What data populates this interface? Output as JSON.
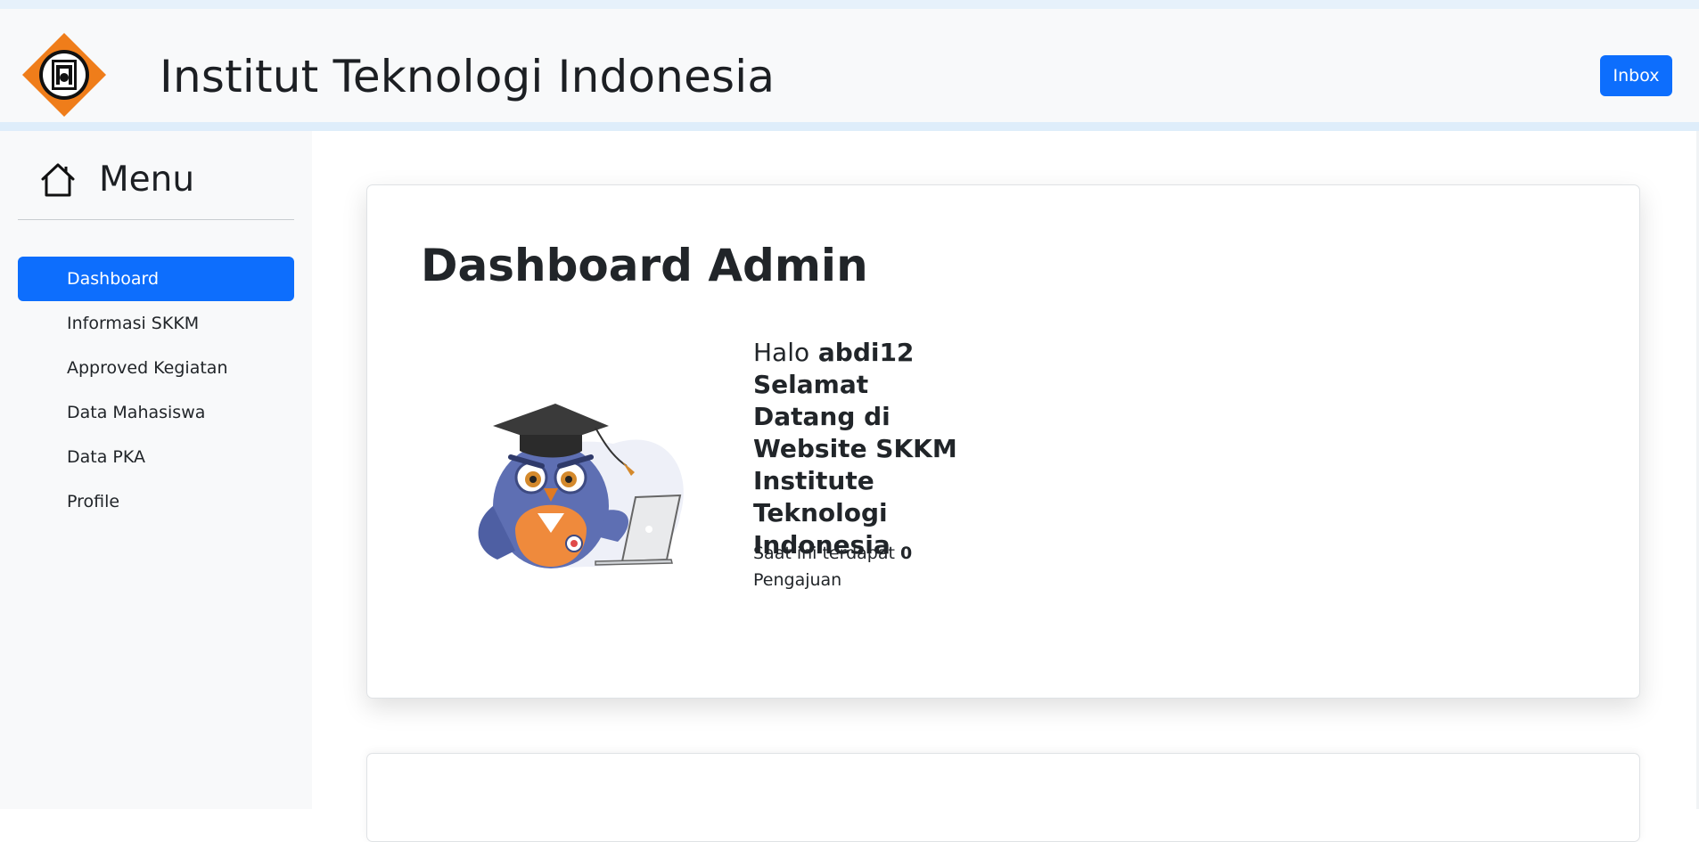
{
  "header": {
    "title": "Institut Teknologi Indonesia",
    "logo": "ITI emblem (orange diamond with black shield)",
    "inbox_label": "Inbox",
    "colors": {
      "background": "#f8f9fa",
      "primary": "#0d6efd",
      "logo_orange": "#ef7d1a"
    }
  },
  "sidebar": {
    "heading_icon": "home-icon",
    "heading": "Menu",
    "items": [
      {
        "label": "Dashboard",
        "active": true
      },
      {
        "label": "Informasi SKKM",
        "active": false
      },
      {
        "label": "Approved Kegiatan",
        "active": false
      },
      {
        "label": "Data Mahasiswa",
        "active": false
      },
      {
        "label": "Data PKA",
        "active": false
      },
      {
        "label": "Profile",
        "active": false
      }
    ]
  },
  "main": {
    "title": "Dashboard Admin",
    "illustration": "owl graduate with laptop",
    "welcome": {
      "greeting": "Halo",
      "username": "abdi12",
      "message": "Selamat Datang di Website SKKM Institute Teknologi Indonesia"
    },
    "submission": {
      "prefix": "Saat ini terdapat",
      "count": "0",
      "suffix": "Pengajuan"
    }
  }
}
